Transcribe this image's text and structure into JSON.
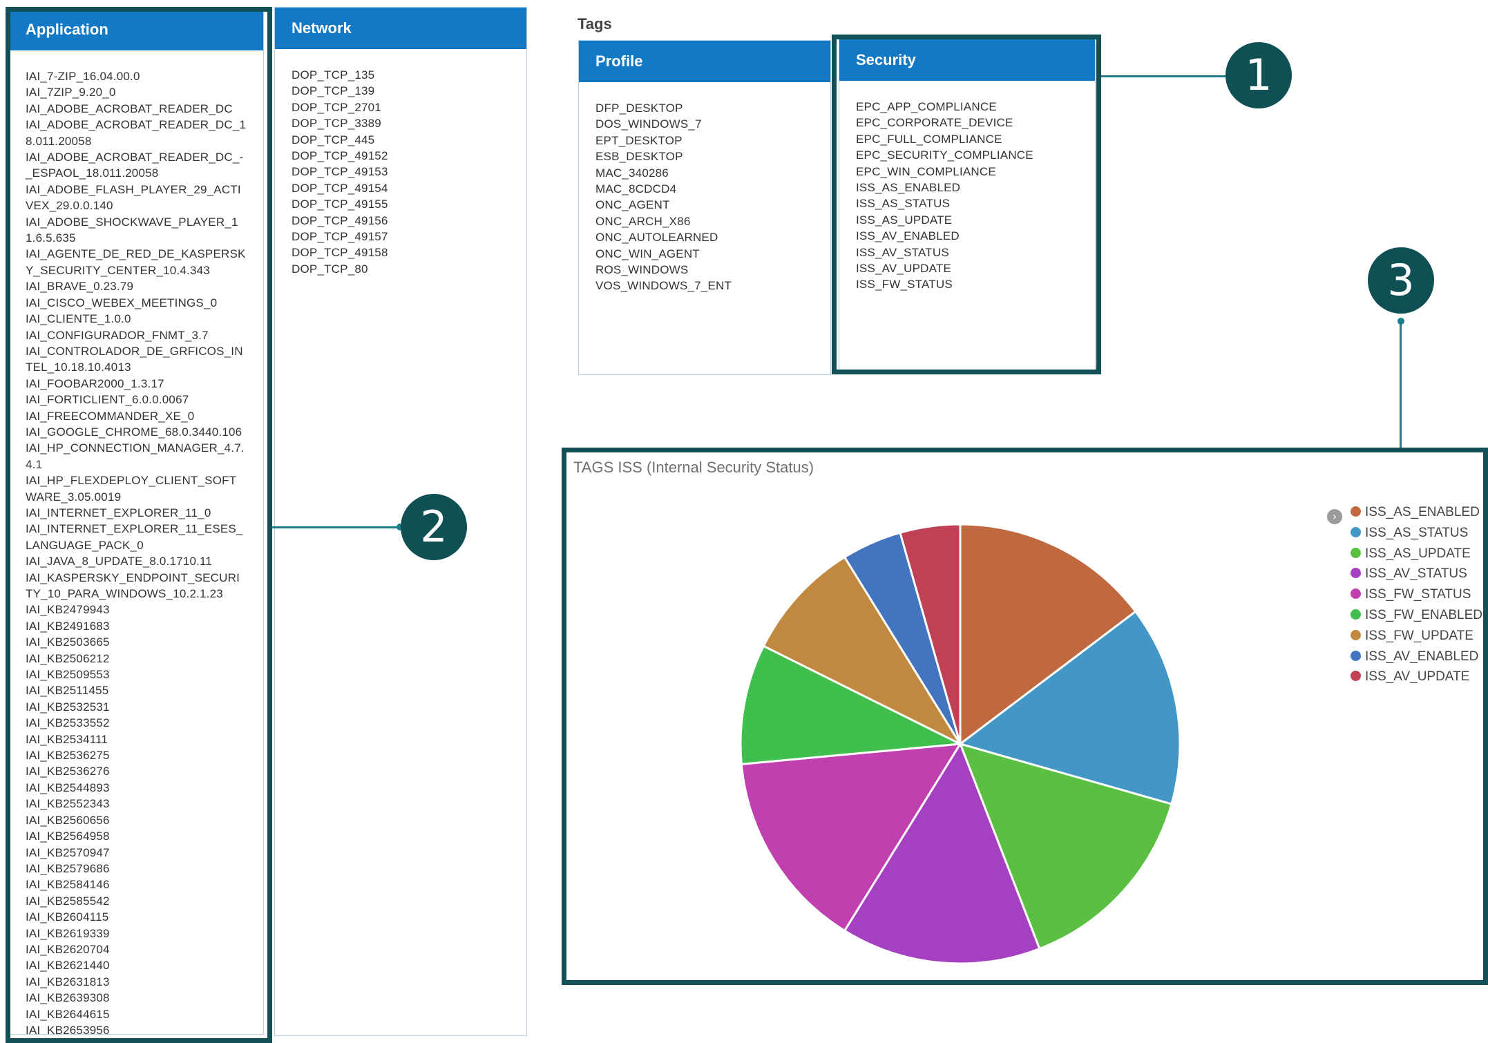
{
  "application": {
    "title": "Application",
    "items": [
      "IAI_7-ZIP_16.04.00.0",
      "IAI_7ZIP_9.20_0",
      "IAI_ADOBE_ACROBAT_READER_DC",
      "IAI_ADOBE_ACROBAT_READER_DC_18.011.20058",
      "IAI_ADOBE_ACROBAT_READER_DC_-_ESPAOL_18.011.20058",
      "IAI_ADOBE_FLASH_PLAYER_29_ACTIVEX_29.0.0.140",
      "IAI_ADOBE_SHOCKWAVE_PLAYER_11.6.5.635",
      "IAI_AGENTE_DE_RED_DE_KASPERSKY_SECURITY_CENTER_10.4.343",
      "IAI_BRAVE_0.23.79",
      "IAI_CISCO_WEBEX_MEETINGS_0",
      "IAI_CLIENTE_1.0.0",
      "IAI_CONFIGURADOR_FNMT_3.7",
      "IAI_CONTROLADOR_DE_GRFICOS_INTEL_10.18.10.4013",
      "IAI_FOOBAR2000_1.3.17",
      "IAI_FORTICLIENT_6.0.0.0067",
      "IAI_FREECOMMANDER_XE_0",
      "IAI_GOOGLE_CHROME_68.0.3440.106",
      "IAI_HP_CONNECTION_MANAGER_4.7.4.1",
      "IAI_HP_FLEXDEPLOY_CLIENT_SOFTWARE_3.05.0019",
      "IAI_INTERNET_EXPLORER_11_0",
      "IAI_INTERNET_EXPLORER_11_ESES_LANGUAGE_PACK_0",
      "IAI_JAVA_8_UPDATE_8.0.1710.11",
      "IAI_KASPERSKY_ENDPOINT_SECURITY_10_PARA_WINDOWS_10.2.1.23",
      "IAI_KB2479943",
      "IAI_KB2491683",
      "IAI_KB2503665",
      "IAI_KB2506212",
      "IAI_KB2509553",
      "IAI_KB2511455",
      "IAI_KB2532531",
      "IAI_KB2533552",
      "IAI_KB2534111",
      "IAI_KB2536275",
      "IAI_KB2536276",
      "IAI_KB2544893",
      "IAI_KB2552343",
      "IAI_KB2560656",
      "IAI_KB2564958",
      "IAI_KB2570947",
      "IAI_KB2579686",
      "IAI_KB2584146",
      "IAI_KB2585542",
      "IAI_KB2604115",
      "IAI_KB2619339",
      "IAI_KB2620704",
      "IAI_KB2621440",
      "IAI_KB2631813",
      "IAI_KB2639308",
      "IAI_KB2644615",
      "IAI_KB2653956"
    ]
  },
  "network": {
    "title": "Network",
    "items": [
      "DOP_TCP_135",
      "DOP_TCP_139",
      "DOP_TCP_2701",
      "DOP_TCP_3389",
      "DOP_TCP_445",
      "DOP_TCP_49152",
      "DOP_TCP_49153",
      "DOP_TCP_49154",
      "DOP_TCP_49155",
      "DOP_TCP_49156",
      "DOP_TCP_49157",
      "DOP_TCP_49158",
      "DOP_TCP_80"
    ]
  },
  "tags": {
    "label": "Tags",
    "profile": {
      "title": "Profile",
      "items": [
        "DFP_DESKTOP",
        "DOS_WINDOWS_7",
        "EPT_DESKTOP",
        "ESB_DESKTOP",
        "MAC_340286",
        "MAC_8CDCD4",
        "ONC_AGENT",
        "ONC_ARCH_X86",
        "ONC_AUTOLEARNED",
        "ONC_WIN_AGENT",
        "ROS_WINDOWS",
        "VOS_WINDOWS_7_ENT"
      ]
    },
    "security": {
      "title": "Security",
      "items": [
        "EPC_APP_COMPLIANCE",
        "EPC_CORPORATE_DEVICE",
        "EPC_FULL_COMPLIANCE",
        "EPC_SECURITY_COMPLIANCE",
        "EPC_WIN_COMPLIANCE",
        "ISS_AS_ENABLED",
        "ISS_AS_STATUS",
        "ISS_AS_UPDATE",
        "ISS_AV_ENABLED",
        "ISS_AV_STATUS",
        "ISS_AV_UPDATE",
        "ISS_FW_STATUS"
      ]
    }
  },
  "callouts": {
    "one": "1",
    "two": "2",
    "three": "3"
  },
  "colors": {
    "header_blue": "#1479c4",
    "highlight": "#124f56",
    "callout": "#0f5055"
  },
  "chart_data": {
    "type": "pie",
    "title": "TAGS ISS (Internal Security Status)",
    "legend_position": "right",
    "slices": [
      {
        "label": "ISS_AS_ENABLED",
        "value": 1,
        "color": "#c0683f"
      },
      {
        "label": "ISS_AS_STATUS",
        "value": 1,
        "color": "#4297c6"
      },
      {
        "label": "ISS_AS_UPDATE",
        "value": 1,
        "color": "#5bbf42"
      },
      {
        "label": "ISS_AV_STATUS",
        "value": 1,
        "color": "#a540c0"
      },
      {
        "label": "ISS_FW_STATUS",
        "value": 1,
        "color": "#c040b0"
      },
      {
        "label": "ISS_FW_ENABLED",
        "value": 0.6,
        "color": "#40bf4e"
      },
      {
        "label": "ISS_FW_UPDATE",
        "value": 0.6,
        "color": "#c0893f"
      },
      {
        "label": "ISS_AV_ENABLED",
        "value": 0.3,
        "color": "#4274c0"
      },
      {
        "label": "ISS_AV_UPDATE",
        "value": 0.3,
        "color": "#c04055"
      }
    ]
  }
}
